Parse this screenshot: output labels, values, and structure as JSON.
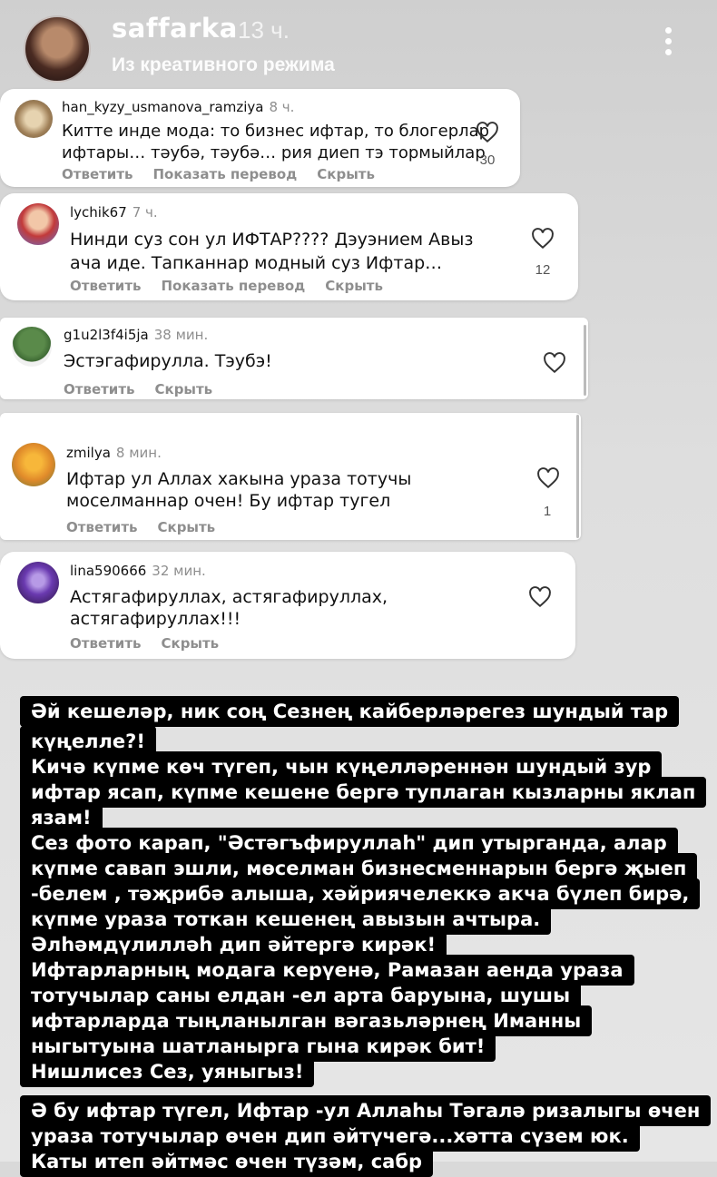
{
  "header": {
    "username": "saffarka",
    "time": "13 ч.",
    "subtitle": "Из креативного режима"
  },
  "comments": [
    {
      "user": "han_kyzy_usmanova_ramziya",
      "time": "8 ч.",
      "lines": [
        "Китте инде мода: то бизнес ифтар, то блогерлар",
        "ифтары… тәубә, тәубә… рия диеп тэ тормыйлар"
      ],
      "likes": "30",
      "actions": [
        "Ответить",
        "Показать перевод",
        "Скрыть"
      ]
    },
    {
      "user": "lychik67",
      "time": "7 ч.",
      "lines": [
        "Нинди суз сон ул ИФТАР???? Дэуэнием Авыз",
        "ача иде. Тапканнар модный суз Ифтар…"
      ],
      "likes": "12",
      "actions": [
        "Ответить",
        "Показать перевод",
        "Скрыть"
      ]
    },
    {
      "user": "g1u2l3f4i5ja",
      "time": "38 мин.",
      "lines": [
        "Эстэгафирулла. Тэубэ!"
      ],
      "likes": "",
      "actions": [
        "Ответить",
        "Скрыть"
      ]
    },
    {
      "user": "zmilya",
      "time": "8 мин.",
      "lines": [
        "Ифтар ул Аллах хакына  ураза тотучы",
        "моселманнар очен! Бу ифтар тугел"
      ],
      "likes": "1",
      "actions": [
        "Ответить",
        "Скрыть"
      ]
    },
    {
      "user": "lina590666",
      "time": "32 мин.",
      "lines": [
        "Астягафируллах, астягафируллах,",
        "астягафируллах!!!"
      ],
      "likes": "",
      "actions": [
        "Ответить",
        "Скрыть"
      ]
    }
  ],
  "story_text": [
    "Әй кешеләр, ник соң Сезнең кайберләрегез шундый тар",
    "күңелле?!",
    "Кичә күпме көч түгеп, чын күңелләреннән шундый зур",
    "ифтар ясап, күпме кешене бергә туплаган кызларны яклап",
    "язам!",
    "Сез фото карап, \"Әстәгъфируллаһ\" дип утырганда, алар",
    "күпме савап эшли, мөселман бизнесменнарын бергә җыеп",
    "-белем , тәҗрибә алыша, хәйриячелеккә акча бүлеп бирә,",
    "күпме ураза тоткан кешенең авызын ачтыра.",
    "Әлһәмдүлилләһ дип әйтергә кирәк!",
    "Ифтарларның модага керүенә, Рамазан аенда  ураза",
    "тотучылар саны елдан -ел арта баруына, шушы",
    "ифтарларда тыңланылган вәгазьләрнең Иманны",
    "ныгытуына шатланырга гына кирәк бит!",
    "Нишлисез Сез, уяныгыз!"
  ],
  "story_text_2": [
    "Ә бу ифтар түгел, Ифтар -ул Аллаһы Тәгалә ризалыгы өчен",
    "ураза тотучылар өчен дип әйтүчегә...хәтта сүзем юк.",
    "Каты итеп әйтмәс өчен түзәм, сабр"
  ],
  "icons": {
    "more": "more-vertical-icon",
    "like": "heart-outline-icon"
  },
  "colors": {
    "card_bg": "#ffffff",
    "text_bg": "#000000",
    "muted": "#8e8e8e"
  }
}
